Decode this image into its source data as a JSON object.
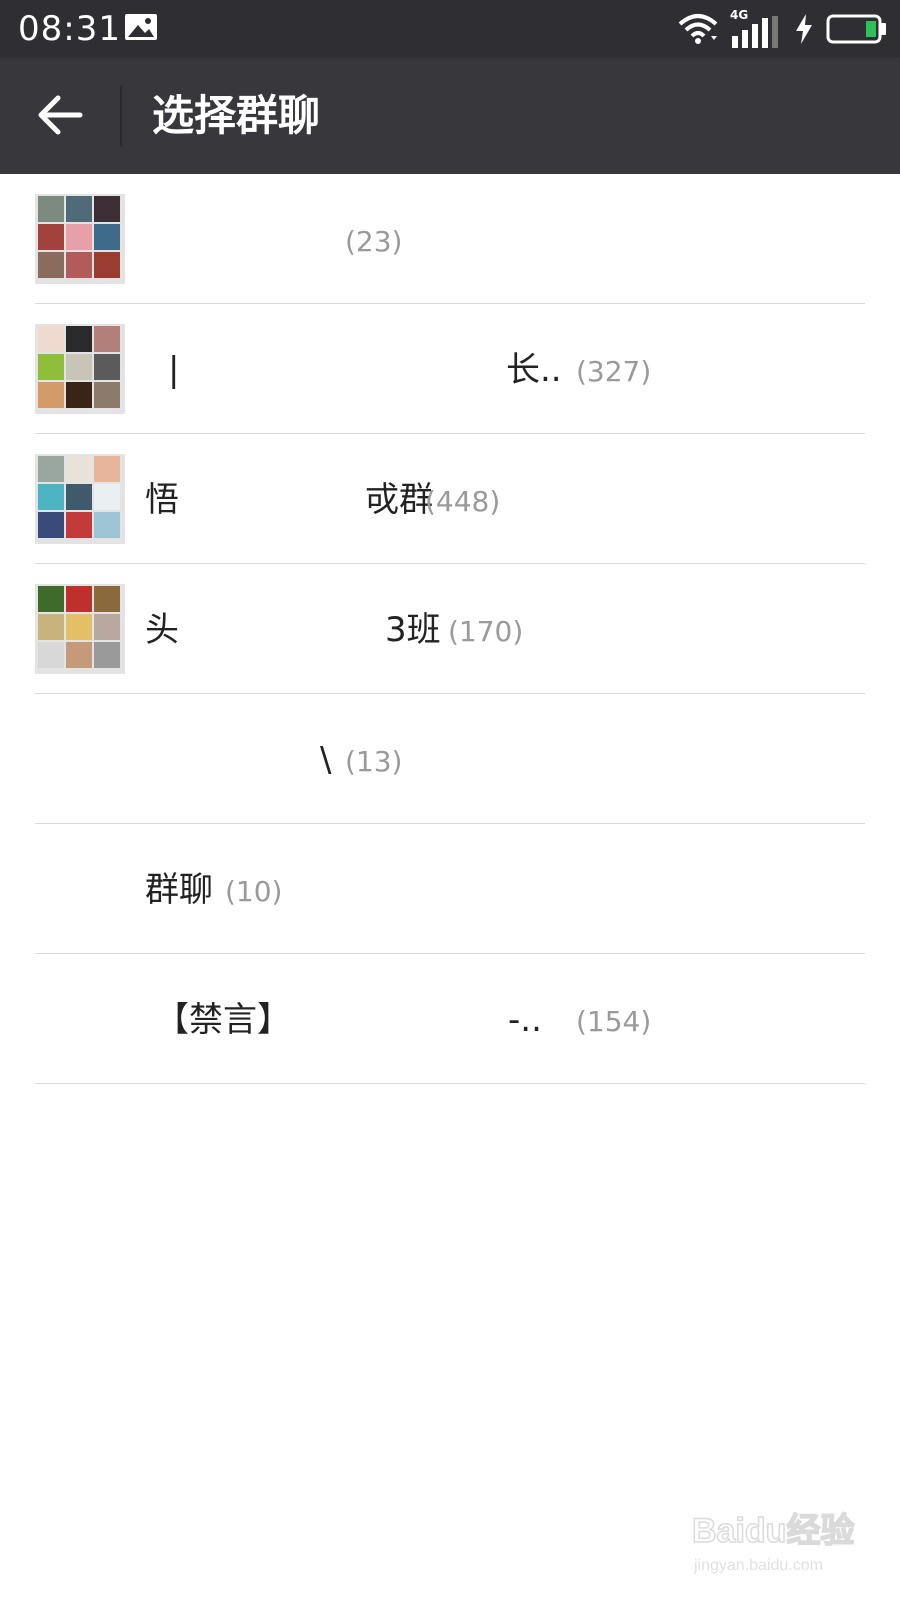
{
  "status_bar": {
    "time": "08:31",
    "network_label": "4G",
    "icons": [
      "image-notification-icon",
      "wifi-icon",
      "signal-icon",
      "charging-icon",
      "battery-icon"
    ],
    "battery_color": "#2ec15a"
  },
  "app_bar": {
    "title": "选择群聊",
    "back_icon": "arrow-left-icon"
  },
  "groups": [
    {
      "name_left": "",
      "name_right": "",
      "count": "(23)",
      "has_avatar": true
    },
    {
      "name_left": "|",
      "name_right": "长..",
      "count": "(327)",
      "has_avatar": true
    },
    {
      "name_left": "悟",
      "name_right": "戓群",
      "count": "(448)",
      "has_avatar": true
    },
    {
      "name_left": "头",
      "name_right": "3班",
      "count": "(170)",
      "has_avatar": true
    },
    {
      "name_left": "",
      "name_right": "\\",
      "count": "(13)",
      "has_avatar": false
    },
    {
      "name_left": "群聊",
      "name_right": "",
      "count": "(10)",
      "has_avatar": false
    },
    {
      "name_left": "【禁言】",
      "name_right": "-..",
      "count": "(154)",
      "has_avatar": false
    }
  ],
  "watermark": {
    "brand": "Baidu经验",
    "url": "jingyan.baidu.com"
  },
  "colors": {
    "status_bar": "#2f2e33",
    "app_bar": "#38373c",
    "divider": "#d9d9d9",
    "count_text": "#9a9a9a"
  }
}
